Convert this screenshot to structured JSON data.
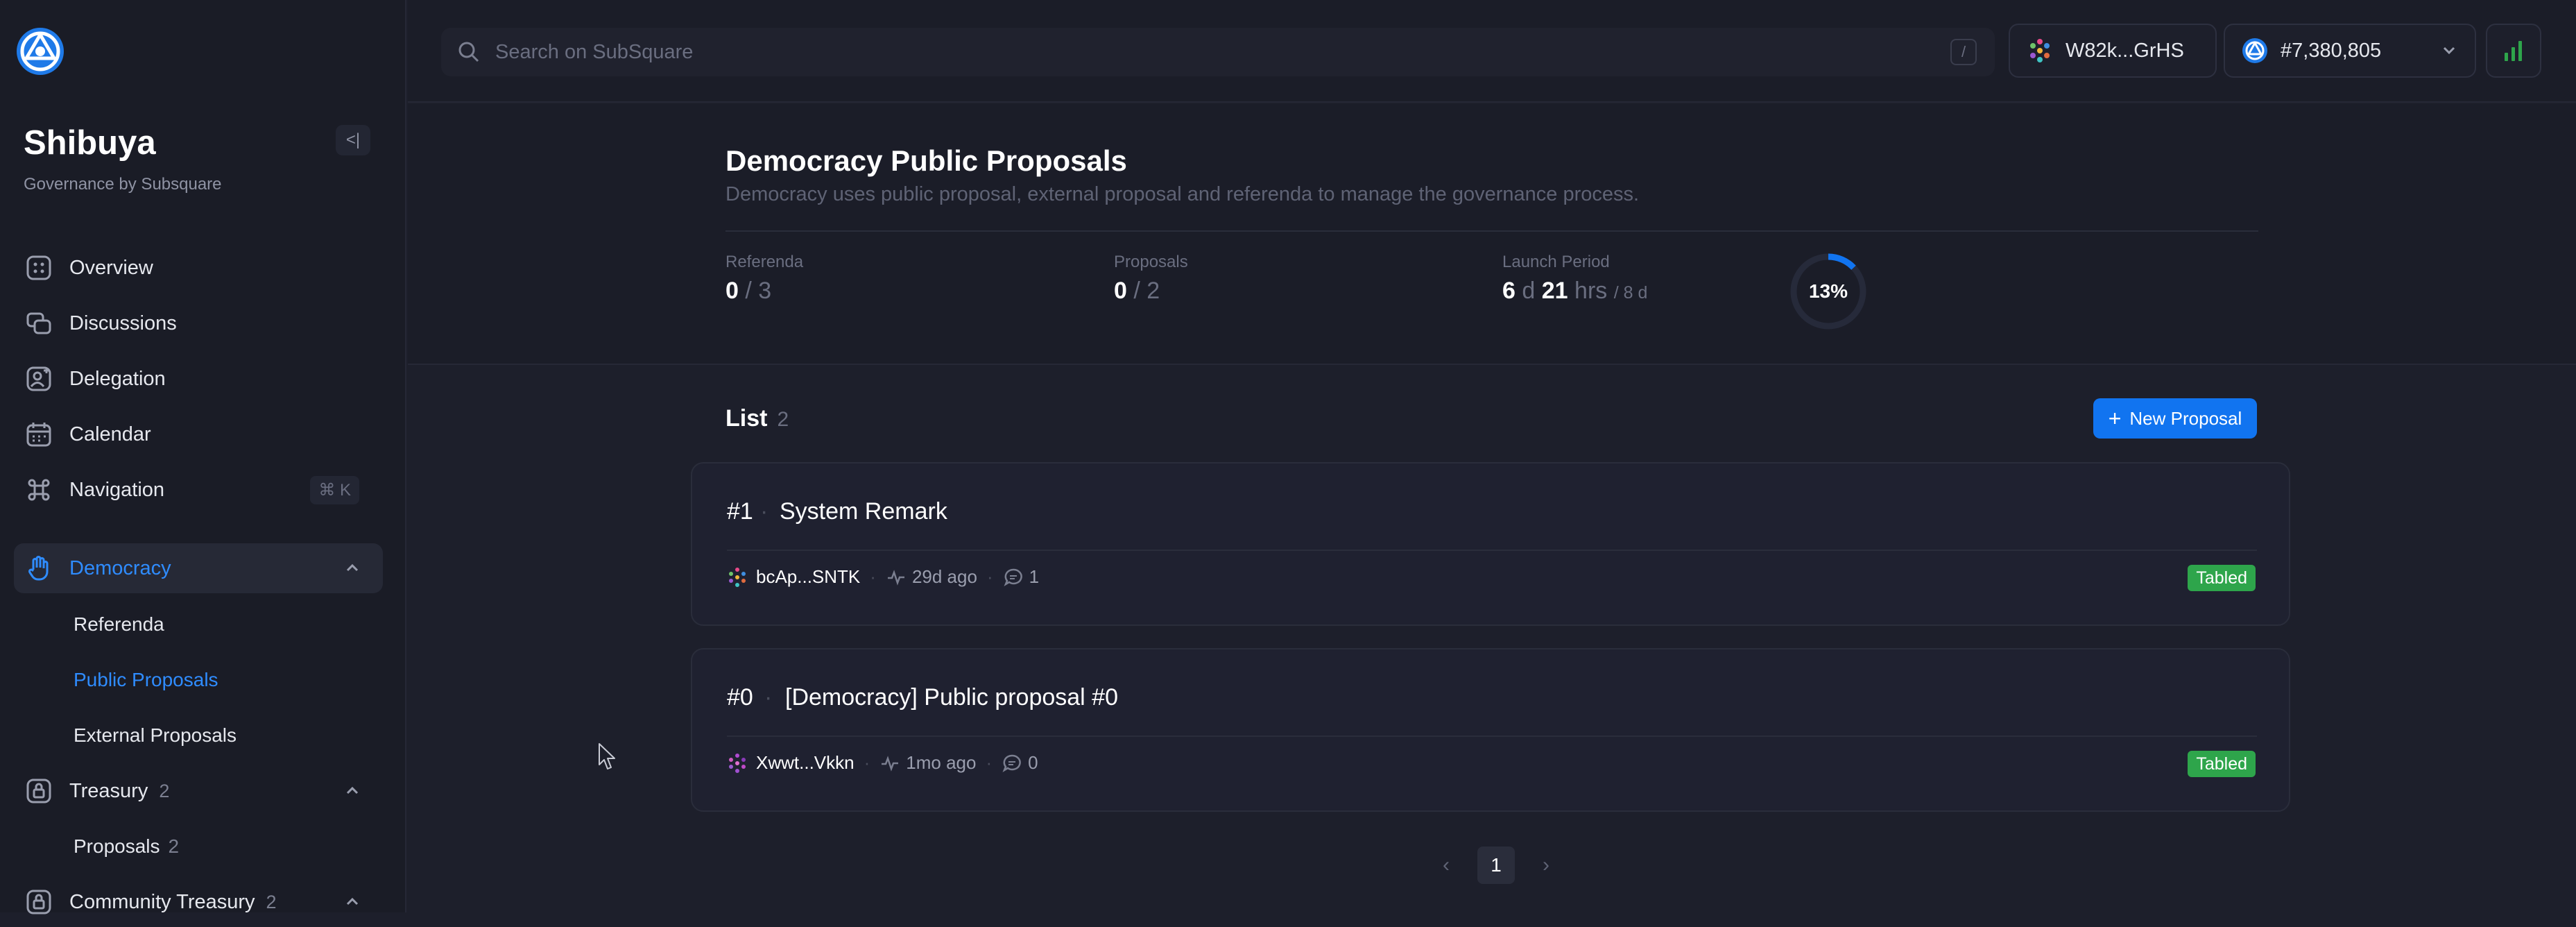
{
  "sidebar": {
    "title": "Shibuya",
    "subtitle": "Governance by Subsquare",
    "items": [
      {
        "label": "Overview"
      },
      {
        "label": "Discussions"
      },
      {
        "label": "Delegation"
      },
      {
        "label": "Calendar"
      },
      {
        "label": "Navigation",
        "shortcut": "⌘ K"
      },
      {
        "label": "Democracy"
      },
      {
        "label": "Treasury",
        "count": "2"
      },
      {
        "label": "Community Treasury",
        "count": "2"
      }
    ],
    "democracy_sub": [
      "Referenda",
      "Public Proposals",
      "External Proposals"
    ],
    "treasury_sub": [
      {
        "label": "Proposals",
        "count": "2"
      }
    ]
  },
  "topbar": {
    "search_placeholder": "Search on SubSquare",
    "search_shortcut": "/",
    "account": "W82k...GrHS",
    "block": "#7,380,805"
  },
  "header": {
    "title": "Democracy Public Proposals",
    "description": "Democracy uses public proposal, external proposal and referenda to manage the governance process.",
    "stats": {
      "referenda_label": "Referenda",
      "referenda_value": "0",
      "referenda_total": "/ 3",
      "proposals_label": "Proposals",
      "proposals_value": "0",
      "proposals_total": "/ 2",
      "launch_label": "Launch Period",
      "launch_d": "6",
      "launch_d_unit": "d",
      "launch_h": "21",
      "launch_h_unit": "hrs",
      "launch_total": "/ 8 d",
      "progress_label": "13%",
      "progress": 0.13
    }
  },
  "list": {
    "title": "List",
    "count": "2",
    "new_button": "New Proposal",
    "items": [
      {
        "index": "#1",
        "title": "System Remark",
        "author": "bcAp...SNTK",
        "time": "29d ago",
        "comments": "1",
        "status": "Tabled"
      },
      {
        "index": "#0",
        "title": "[Democracy] Public proposal #0",
        "author": "Xwwt...Vkkn",
        "time": "1mo ago",
        "comments": "0",
        "status": "Tabled"
      }
    ]
  },
  "pagination": {
    "current": "1"
  },
  "colors": {
    "accent": "#1174f0",
    "active_text": "#2f8cff",
    "tabled": "#2ea54b",
    "background": "#1d1f2b"
  }
}
